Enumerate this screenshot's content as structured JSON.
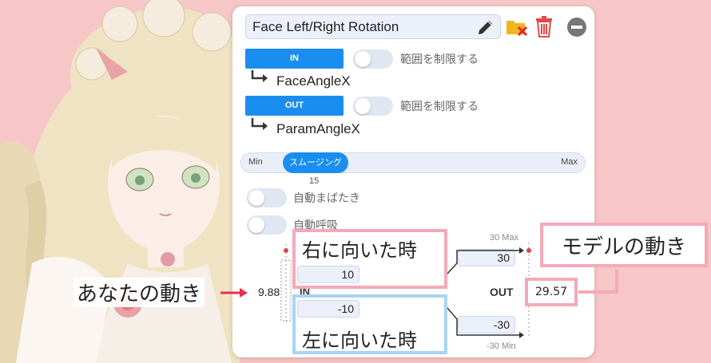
{
  "header": {
    "name_value": "Face Left/Right Rotation"
  },
  "icons": {
    "edit": "pencil-icon",
    "folder": "folder-remove-icon",
    "delete": "trash-icon",
    "remove": "minus-circle-icon"
  },
  "input": {
    "button_label": "IN",
    "limit_toggle_label": "範囲を制限する",
    "limit_enabled": false,
    "param_name": "FaceAngleX"
  },
  "output": {
    "button_label": "OUT",
    "limit_toggle_label": "範囲を制限する",
    "limit_enabled": false,
    "param_name": "ParamAngleX"
  },
  "smoothing": {
    "min_label": "Min",
    "max_label": "Max",
    "thumb_label": "スムージング",
    "value": "15"
  },
  "auto_blink": {
    "label": "自動まばたき",
    "enabled": false
  },
  "auto_breath": {
    "label": "自動呼吸",
    "enabled": false
  },
  "mapping": {
    "in_current": "9.88",
    "in_label": "IN",
    "in_max_value": "10",
    "in_min_value": "-10",
    "out_label": "OUT",
    "out_current": "29.57",
    "out_max_value": "30",
    "out_min_value": "-30",
    "out_max_caption": "30 Max",
    "out_min_caption": "-30 Min"
  },
  "annotations": {
    "your_movement": "あなたの動き",
    "model_movement": "モデルの動き",
    "facing_right": "右に向いた時",
    "facing_left": "左に向いた時"
  },
  "colors": {
    "background": "#f7c6c6",
    "accent_blue": "#1a8ef0",
    "pink_callout": "#f5a9b8",
    "blue_callout": "#a8d4f4",
    "arrow_red": "#e8304a"
  }
}
